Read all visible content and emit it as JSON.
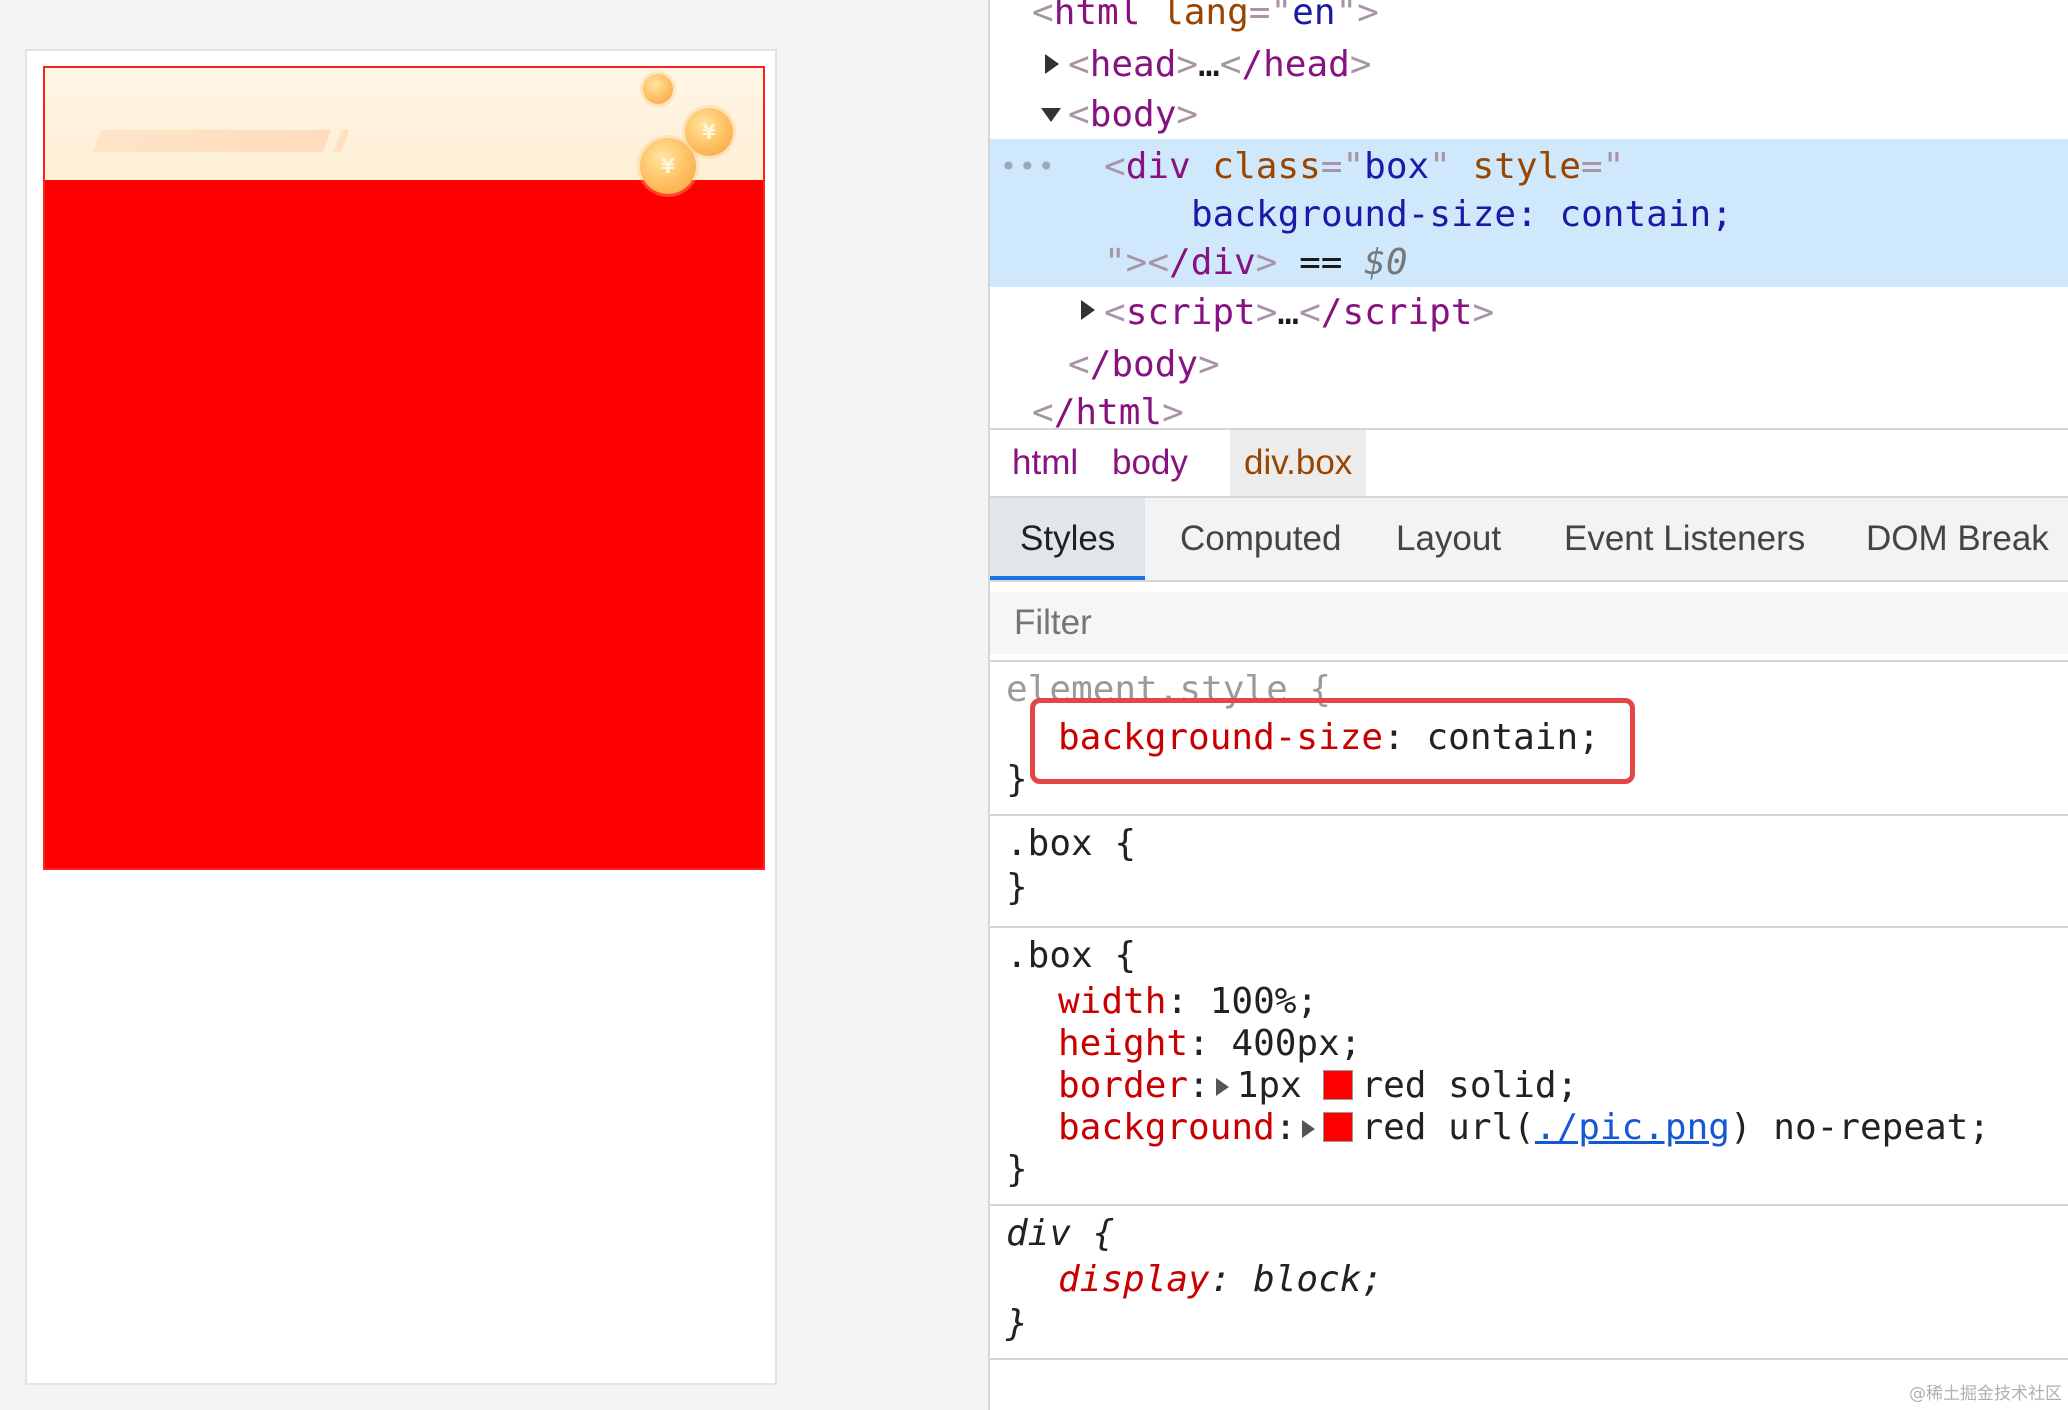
{
  "dom_tree": {
    "html_open": {
      "tag": "html",
      "attr": "lang",
      "value": "en"
    },
    "head": {
      "open": "head",
      "ellipsis": "…",
      "close": "/head"
    },
    "body_open": "body",
    "div": {
      "tag": "div",
      "attr1": "class",
      "val1": "box",
      "attr2": "style",
      "style_text": "background-size: contain;",
      "close": "/div",
      "eq": "==",
      "var": "$0"
    },
    "script": {
      "open": "script",
      "ellipsis": "…",
      "close": "/script"
    },
    "body_close": "/body",
    "html_close": "/html"
  },
  "breadcrumb": [
    "html",
    "body",
    "div.box"
  ],
  "tabs": [
    "Styles",
    "Computed",
    "Layout",
    "Event Listeners",
    "DOM Break"
  ],
  "filter": {
    "placeholder": "Filter"
  },
  "styles": {
    "element_style": {
      "selector": "element.style {",
      "prop": "background-size",
      "value": "contain;"
    },
    "box_empty": {
      "selector": ".box {"
    },
    "box_rule": {
      "selector": ".box {",
      "width": {
        "prop": "width",
        "value": "100%;"
      },
      "height": {
        "prop": "height",
        "value": "400px;"
      },
      "border": {
        "prop": "border",
        "value_a": "1px",
        "color": "red",
        "value_b": "solid;"
      },
      "background": {
        "prop": "background",
        "color": "red",
        "url_pre": "url(",
        "url": "./pic.png",
        "url_post": ") no-repeat;"
      }
    },
    "div_rule": {
      "selector": "div {",
      "prop": "display",
      "value": "block;"
    },
    "close_brace": "}"
  },
  "colors": {
    "accent": "#1a73e8",
    "highlight": "#e64545",
    "red": "#ff0000"
  },
  "watermark": "@稀土掘金技术社区"
}
